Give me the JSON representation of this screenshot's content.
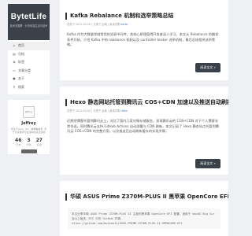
{
  "brand": {
    "title": "BytetLife",
    "subtitle": "技术无国界 · 分享改变生活与技术"
  },
  "nav": {
    "items": [
      {
        "label": "首页",
        "icon": "home-icon"
      },
      {
        "label": "归档",
        "icon": "archive-icon"
      },
      {
        "label": "标签",
        "icon": "tag-icon"
      },
      {
        "label": "文章分类",
        "icon": "folder-icon"
      },
      {
        "label": "关于",
        "icon": "user-icon"
      },
      {
        "label": "搜索",
        "icon": "search-icon"
      }
    ]
  },
  "profile": {
    "avatar_alt": "Jeffrey",
    "name": "Jeffrey",
    "desc": "专注于Java、Go、前端等技术, 乐于分享技术与生活中的点点滴滴",
    "stats": [
      {
        "n": "46",
        "l": "日志"
      },
      {
        "n": "3",
        "l": "分类"
      },
      {
        "n": "27",
        "l": "标签"
      }
    ]
  },
  "posts": [
    {
      "title": "Kafka Rebalance 机制和选举策略总结",
      "meta": "发表于 2021-05-20 | 分类于 后端 | 阅读次数",
      "tag": "Kafka",
      "body": "Kafka 作为大数据领域常用的消息中间件，其核心原理值得开发者深入学习，本文从 Rebalance 的触发条件开始，介绍 Kafka 中的 rebalance 机制以及 controller broker 选举机制，最后总结相关选举策略。",
      "btn": "阅读全文 »"
    },
    {
      "title": "Hexo 静态网站托管到腾讯云 COS+CDN 加速以及推送自动刷新完美方案",
      "meta": "发表于 2021-05-02 | 分类于 运维 | 阅读次数",
      "tag": "Hexo",
      "body": "近期把博客托管到腾讯云上，对比了国内几家对象存储服务，发现腾讯云的 COS+CDN 对于个人博客非常合适，同时腾讯云支持 GitHub Actions 自动部署与 CDN 刷新，本文记录了 Hexo 静态站点托管到腾讯云 COS+CDN 的完整方案，以及推送后自动刷新缓存的实现步骤。",
      "btn": "阅读全文 »"
    },
    {
      "title": "华硕 ASUS Prime Z370M-PLUS II 黑苹果 OpenCore EFI",
      "code": "本文分享华硕 ASUS Prime Z370M-PLUS II 主板的黑苹果 OpenCore EFI 配置，适用于 macOS Big Sur 及以上版本，EFI 已在 GitHub 开源。\nhttps://github.com/bushanfu/ASUS-PRIME-Z370M-PLUS-II-OPENCORE-EFI"
    }
  ]
}
